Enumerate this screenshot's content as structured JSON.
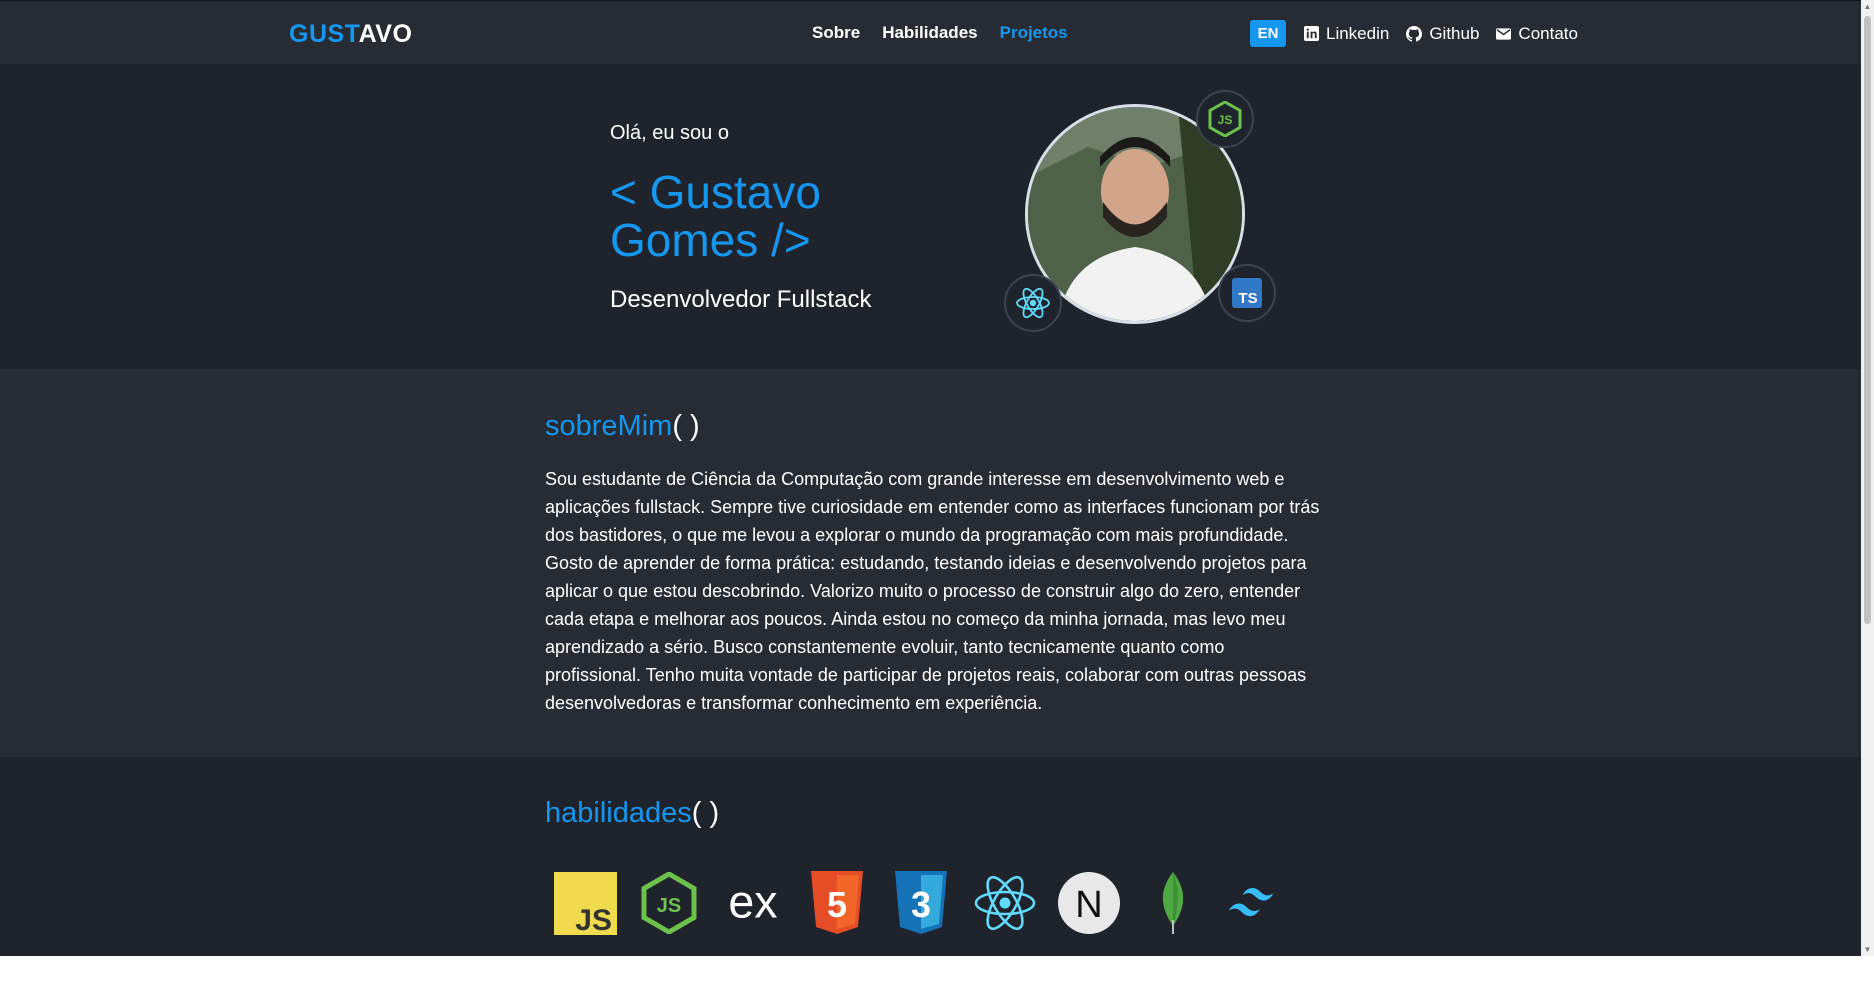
{
  "navbar": {
    "logo_part1": "GUST",
    "logo_part2": "AVO",
    "links": [
      "Sobre",
      "Habilidades",
      "Projetos"
    ],
    "active_link": "Projetos",
    "lang_button": "EN",
    "social": [
      {
        "label": "Linkedin",
        "icon": "linkedin-icon"
      },
      {
        "label": "Github",
        "icon": "github-icon"
      },
      {
        "label": "Contato",
        "icon": "mail-icon"
      }
    ]
  },
  "hero": {
    "greeting": "Olá, eu sou o",
    "name": "< Gustavo\nGomes />",
    "role": "Desenvolvedor Fullstack",
    "badges": [
      "nodejs-icon",
      "react-icon",
      "typescript-icon"
    ]
  },
  "about": {
    "title_fn": "sobreMim",
    "title_paren": "( )",
    "text": "Sou estudante de Ciência da Computação com grande interesse em desenvolvimento web e aplicações fullstack. Sempre tive curiosidade em entender como as interfaces funcionam por trás dos bastidores, o que me levou a explorar o mundo da programação com mais profundidade. Gosto de aprender de forma prática: estudando, testando ideias e desenvolvendo projetos para aplicar o que estou descobrindo. Valorizo muito o processo de construir algo do zero, entender cada etapa e melhorar aos poucos. Ainda estou no começo da minha jornada, mas levo meu aprendizado a sério. Busco constantemente evoluir, tanto tecnicamente quanto como profissional. Tenho muita vontade de participar de projetos reais, colaborar com outras pessoas desenvolvedoras e transformar conhecimento em experiência."
  },
  "skills": {
    "title_fn": "habilidades",
    "title_paren": "( )",
    "icons": [
      "javascript-icon",
      "nodejs-icon",
      "express-icon",
      "html5-icon",
      "css3-icon",
      "react-icon",
      "nextjs-icon",
      "mongodb-icon",
      "tailwind-icon"
    ],
    "js_label": "JS",
    "express_label": "ex",
    "html_label": "5",
    "css_label": "3",
    "next_label": "N",
    "ts_label": "TS"
  },
  "colors": {
    "accent": "#1597f0",
    "bg_dark": "#1e232c",
    "bg_mid": "#272b33"
  }
}
